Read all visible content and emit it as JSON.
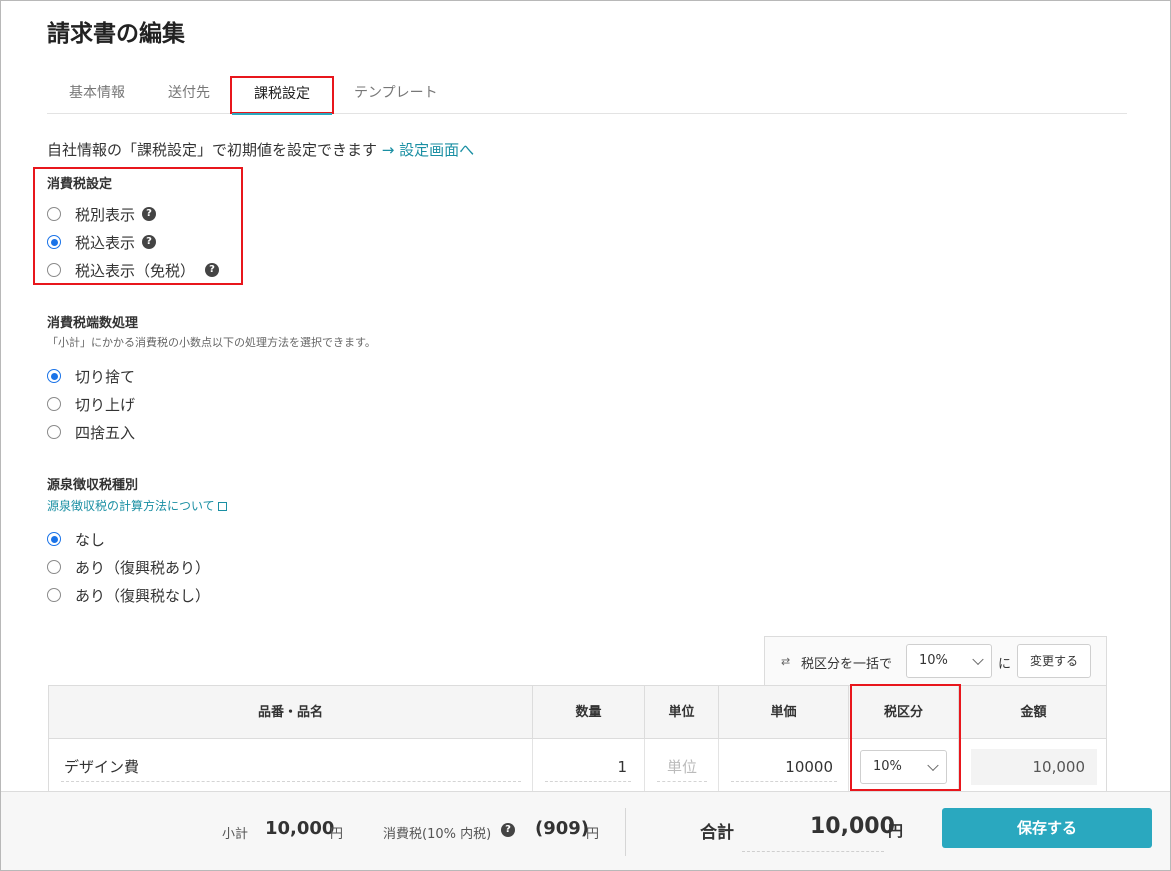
{
  "page": {
    "title": "請求書の編集"
  },
  "tabs": [
    {
      "label": "基本情報"
    },
    {
      "label": "送付先"
    },
    {
      "label": "課税設定",
      "active": true
    },
    {
      "label": "テンプレート"
    }
  ],
  "intro": {
    "text": "自社情報の「課税設定」で初期値を設定できます",
    "link": "→ 設定画面へ"
  },
  "tax_display": {
    "title": "消費税設定",
    "options": [
      {
        "label": "税別表示",
        "selected": false
      },
      {
        "label": "税込表示",
        "selected": true
      },
      {
        "label": "税込表示（免税）",
        "selected": false
      }
    ]
  },
  "rounding": {
    "title": "消費税端数処理",
    "hint": "「小計」にかかる消費税の小数点以下の処理方法を選択できます。",
    "options": [
      {
        "label": "切り捨て",
        "selected": true
      },
      {
        "label": "切り上げ",
        "selected": false
      },
      {
        "label": "四捨五入",
        "selected": false
      }
    ]
  },
  "withholding": {
    "title": "源泉徴収税種別",
    "link": "源泉徴収税の計算方法について",
    "options": [
      {
        "label": "なし",
        "selected": true
      },
      {
        "label": "あり（復興税あり）",
        "selected": false
      },
      {
        "label": "あり（復興税なし）",
        "selected": false
      }
    ]
  },
  "bulk": {
    "label": "税区分を一括で",
    "value": "10%",
    "suffix": "に",
    "button": "変更する"
  },
  "table": {
    "headers": [
      "品番・品名",
      "数量",
      "単位",
      "単価",
      "税区分",
      "金額"
    ],
    "rows": [
      {
        "name": "デザイン費",
        "qty": "1",
        "unit_placeholder": "単位",
        "price": "10000",
        "tax": "10%",
        "amount": "10,000"
      }
    ]
  },
  "footer": {
    "subtotal_label": "小計",
    "subtotal_value": "10,000",
    "currency": "円",
    "tax_label": "消費税(10% 内税)",
    "tax_value": "(909)",
    "total_label": "合計",
    "total_value": "10,000",
    "save_button": "保存する"
  },
  "colors": {
    "accent": "#2aa8bf",
    "highlight": "#e8161c",
    "radio": "#1a73e8"
  }
}
